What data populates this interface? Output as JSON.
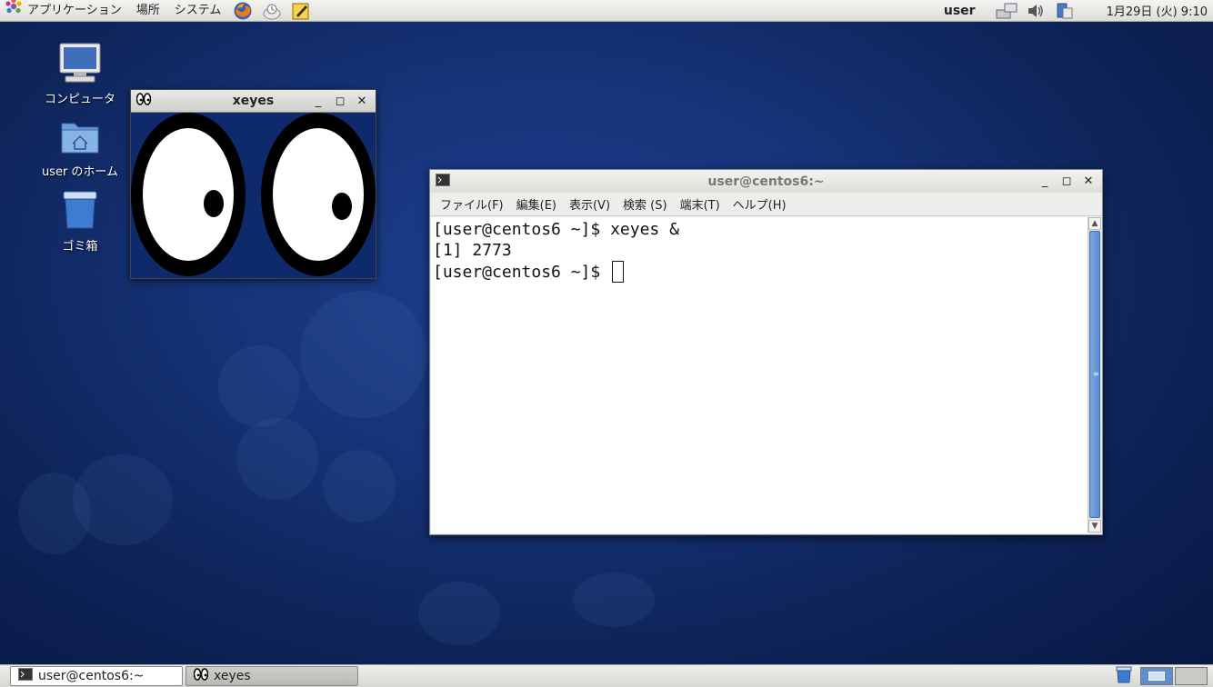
{
  "top_panel": {
    "menus": [
      "アプリケーション",
      "場所",
      "システム"
    ],
    "launchers": [
      "firefox-icon",
      "mail-client-icon",
      "notes-editor-icon"
    ],
    "user": "user",
    "clock": "1月29日 (火)  9:10"
  },
  "desktop_icons": [
    {
      "label": "コンピュータ",
      "icon": "computer-icon"
    },
    {
      "label": "user のホーム",
      "icon": "home-folder-icon"
    },
    {
      "label": "ゴミ箱",
      "icon": "trash-icon"
    }
  ],
  "xeyes_window": {
    "title": "xeyes"
  },
  "terminal_window": {
    "title": "user@centos6:~",
    "menu": [
      "ファイル(F)",
      "編集(E)",
      "表示(V)",
      "検索 (S)",
      "端末(T)",
      "ヘルプ(H)"
    ],
    "lines": [
      "[user@centos6 ~]$ xeyes &",
      "[1] 2773",
      "[user@centos6 ~]$ "
    ]
  },
  "taskbar": {
    "tasks": [
      {
        "label": "user@centos6:~",
        "icon": "terminal-icon",
        "active": true
      },
      {
        "label": "xeyes",
        "icon": "xeyes-icon",
        "active": false
      }
    ]
  }
}
